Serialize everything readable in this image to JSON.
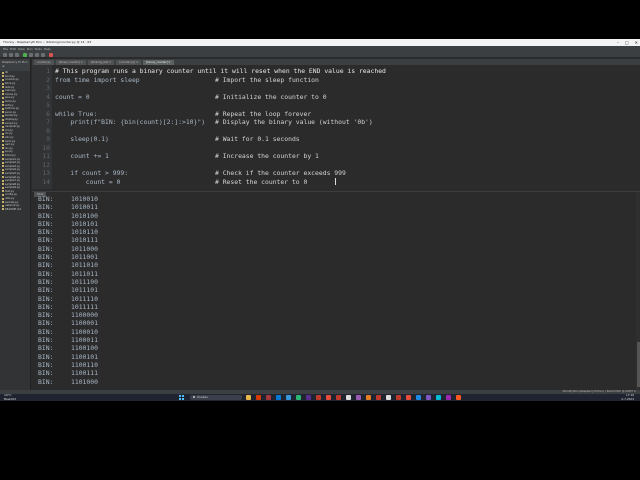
{
  "window": {
    "title": "Thonny  -  RaspberryPi Pico :: /blinking/counter.py  @  14 : 63",
    "controls": [
      "–",
      "□",
      "✕"
    ]
  },
  "menu": [
    "File",
    "Edit",
    "View",
    "Run",
    "Tools",
    "Help"
  ],
  "sidebar": {
    "header": "Raspberry Pi Pico ≡",
    "items": [
      "lib",
      "boot.py",
      "counter.py",
      "blink.py",
      "leds.py",
      "main.py",
      "morse.py",
      "pins.py",
      "temp.py",
      "wifi.py",
      "buttons.py",
      "servo.py",
      "buzzer.py",
      "display.py",
      "sensor.py",
      "neopixel.py",
      "lcd.py",
      "rtc.py",
      "adc.py",
      "pwm.py",
      "uart.py",
      "i2c.py",
      "spi.py",
      "timer.py",
      "sample1.py",
      "sample2.py",
      "sample3.py",
      "sample4.py",
      "sample5.py",
      "sample6.py",
      "sample7.py",
      "sample8.py",
      "sample9.py",
      "test.py",
      "config.py",
      "utils.py",
      "secrets.py",
      "network.py",
      "README.md"
    ]
  },
  "tabs": [
    {
      "label": "counter.py",
      "active": false
    },
    {
      "label": "[binary counter] ×",
      "active": false
    },
    {
      "label": "[blinking_led] ×",
      "active": false
    },
    {
      "label": "[counter.py] ×",
      "active": false
    },
    {
      "label": "[binary_counter] ×",
      "active": true
    }
  ],
  "editor": {
    "lines": [
      {
        "n": "1",
        "code": "# This program runs a binary counter until it will reset when the END value is reached",
        "comment": ""
      },
      {
        "n": "2",
        "code": "from time import sleep",
        "comment": "# Import the sleep function"
      },
      {
        "n": "3",
        "code": "",
        "comment": ""
      },
      {
        "n": "4",
        "code": "count = 0",
        "comment": "# Initialize the counter to 0"
      },
      {
        "n": "5",
        "code": "",
        "comment": ""
      },
      {
        "n": "6",
        "code": "while True:",
        "comment": "# Repeat the loop forever"
      },
      {
        "n": "7",
        "code": "    print(f\"BIN: {bin(count)[2:]:>10}\")",
        "comment": "# Display the binary value (without '0b')"
      },
      {
        "n": "8",
        "code": "",
        "comment": ""
      },
      {
        "n": "9",
        "code": "    sleep(0.1)",
        "comment": "# Wait for 0.1 seconds"
      },
      {
        "n": "10",
        "code": "",
        "comment": ""
      },
      {
        "n": "11",
        "code": "    count += 1",
        "comment": "# Increase the counter by 1"
      },
      {
        "n": "12",
        "code": "",
        "comment": ""
      },
      {
        "n": "13",
        "code": "    if count > 999:",
        "comment": "# Check if the counter exceeds 999"
      },
      {
        "n": "14",
        "code": "        count = 0",
        "comment": "# Reset the counter to 0"
      }
    ]
  },
  "shell": {
    "title": "Shell",
    "label": "BIN:",
    "values": [
      "1010010",
      "1010011",
      "1010100",
      "1010101",
      "1010110",
      "1010111",
      "1011000",
      "1011001",
      "1011010",
      "1011011",
      "1011100",
      "1011101",
      "1011110",
      "1011111",
      "1100000",
      "1100001",
      "1100010",
      "1100011",
      "1100100",
      "1100101",
      "1100110",
      "1100111",
      "1101000"
    ]
  },
  "status": {
    "right": "MicroPython (Raspberry Pi Pico)  •  Board CDC @ COM7  ≡"
  },
  "taskbar": {
    "weather_temp": "10°C",
    "weather_desc": "Bewölkt",
    "search_placeholder": "Zoeken",
    "time": "17:16",
    "date": "2-7-2024"
  },
  "colors": {
    "editor_bg": "#2b2b2b",
    "gutter_bg": "#313335",
    "text": "#a9b7c6",
    "taskbar_bg": "#1f2430",
    "start_accent": "#4cc2ff"
  }
}
